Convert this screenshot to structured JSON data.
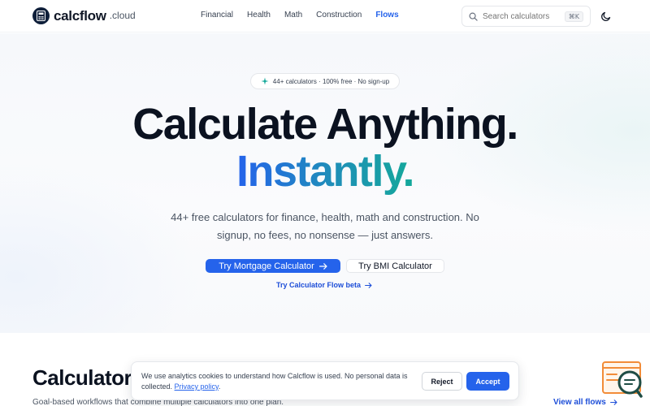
{
  "header": {
    "logo_name": "calcflow",
    "logo_tld": ".cloud",
    "nav": [
      {
        "label": "Financial",
        "active": false
      },
      {
        "label": "Health",
        "active": false
      },
      {
        "label": "Math",
        "active": false
      },
      {
        "label": "Construction",
        "active": false
      },
      {
        "label": "Flows",
        "active": true
      }
    ],
    "search": {
      "placeholder": "Search calculators",
      "shortcut": "⌘K"
    },
    "theme_toggle_icon": "moon-icon"
  },
  "hero": {
    "badge": "44+ calculators · 100% free · No sign-up",
    "title_line1": "Calculate Anything.",
    "title_line2": "Instantly.",
    "subtitle": "44+ free calculators for finance, health, math and construction. No signup, no fees, no nonsense — just answers.",
    "primary_cta": "Try Mortgage Calculator",
    "secondary_cta": "Try BMI Calculator",
    "flow_link": "Try Calculator Flow beta"
  },
  "section": {
    "title": "Calculator",
    "subtitle": "Goal-based workflows that combine multiple calculators into one plan.",
    "view_all": "View all flows"
  },
  "cookie": {
    "text": "We use analytics cookies to understand how Calcflow is used. No personal data is collected.",
    "privacy_link": "Privacy policy",
    "privacy_suffix": ".",
    "reject": "Reject",
    "accept": "Accept"
  },
  "colors": {
    "accent": "#2563eb",
    "title": "#0b1220",
    "gradient_start": "#2563eb",
    "gradient_end": "#14a89a",
    "widget_orange": "#f28c38",
    "widget_green": "#1f4d45"
  }
}
